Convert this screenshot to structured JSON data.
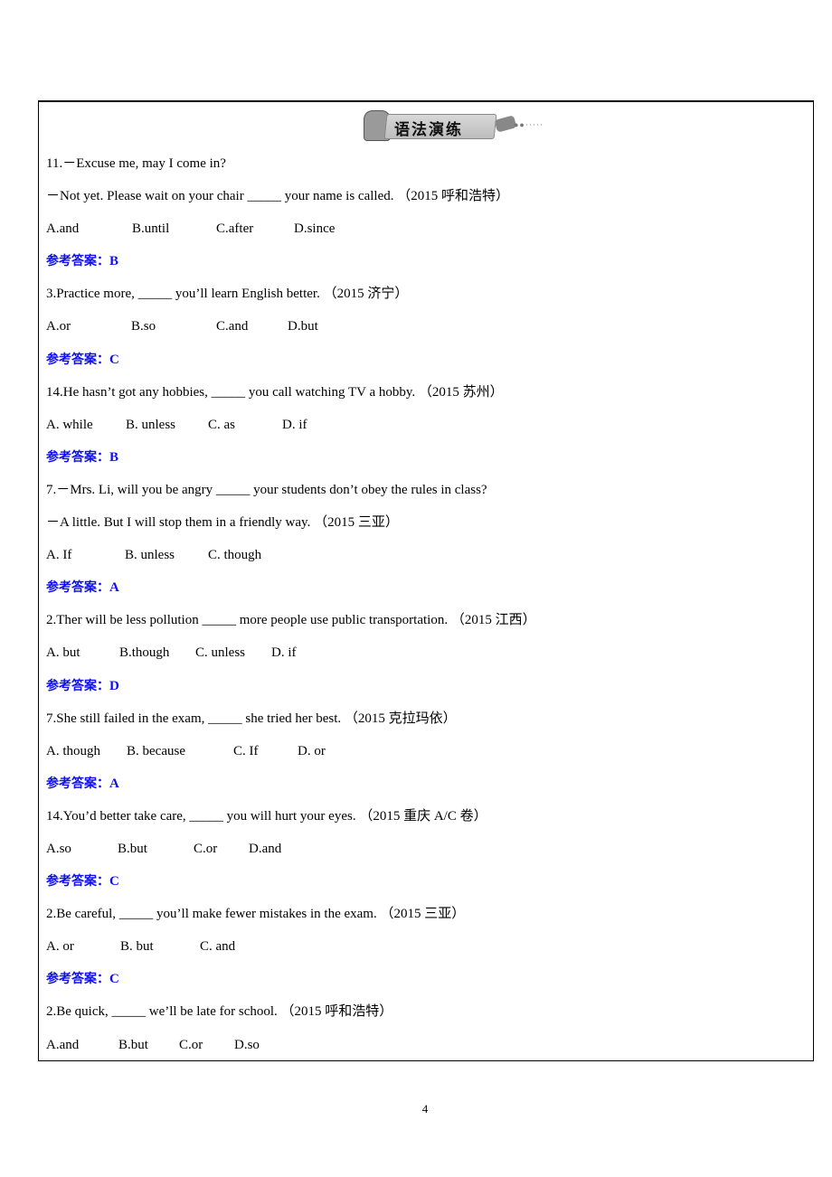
{
  "section_title": "语法演练",
  "answer_label": "参考答案：",
  "items": [
    {
      "lines": [
        "11.－Excuse me, may I come in?",
        "－Not yet. Please wait on your chair _____ your name is called. （2015 呼和浩特）"
      ],
      "options": [
        "A.and",
        "B.until",
        "C.after",
        "D.since"
      ],
      "answer": "B"
    },
    {
      "lines": [
        "3.Practice more, _____ you’ll learn English better. （2015 济宁）"
      ],
      "options": [
        "A.or",
        "B.so",
        "C.and",
        "D.but"
      ],
      "answer": "C"
    },
    {
      "lines": [
        "14.He hasn’t got any hobbies, _____ you call watching TV a hobby. （2015 苏州）"
      ],
      "options": [
        "A. while",
        "B. unless",
        "C. as",
        "D. if"
      ],
      "answer": "B"
    },
    {
      "lines": [
        "7.－Mrs. Li, will you be angry _____ your students don’t obey the rules in class?",
        "－A little. But I will stop them in a friendly way. （2015 三亚）"
      ],
      "options": [
        "A. If",
        "B. unless",
        "C. though"
      ],
      "answer": "A"
    },
    {
      "lines": [
        "2.Ther will be less pollution _____ more people use public transportation. （2015 江西）"
      ],
      "options": [
        "A. but",
        "B.though",
        "C. unless",
        "D. if"
      ],
      "answer": "D"
    },
    {
      "lines": [
        "7.She still failed in the exam, _____ she tried her best. （2015 克拉玛依）"
      ],
      "options": [
        "A. though",
        "B. because",
        "C. If",
        "D. or"
      ],
      "answer": "A"
    },
    {
      "lines": [
        "14.You’d better take care, _____ you will hurt your eyes. （2015 重庆 A/C 卷）"
      ],
      "options": [
        "A.so",
        "B.but",
        "C.or",
        "D.and"
      ],
      "answer": "C"
    },
    {
      "lines": [
        "2.Be careful, _____ you’ll make fewer mistakes in the exam. （2015 三亚）"
      ],
      "options": [
        "A. or",
        "B. but",
        "C. and"
      ],
      "answer": "C"
    },
    {
      "lines": [
        "2.Be quick, _____ we’ll be late for school. （2015 呼和浩特）"
      ],
      "options": [
        "A.and",
        "B.but",
        "C.or",
        "D.so"
      ],
      "answer": null
    }
  ],
  "page_number": "4"
}
